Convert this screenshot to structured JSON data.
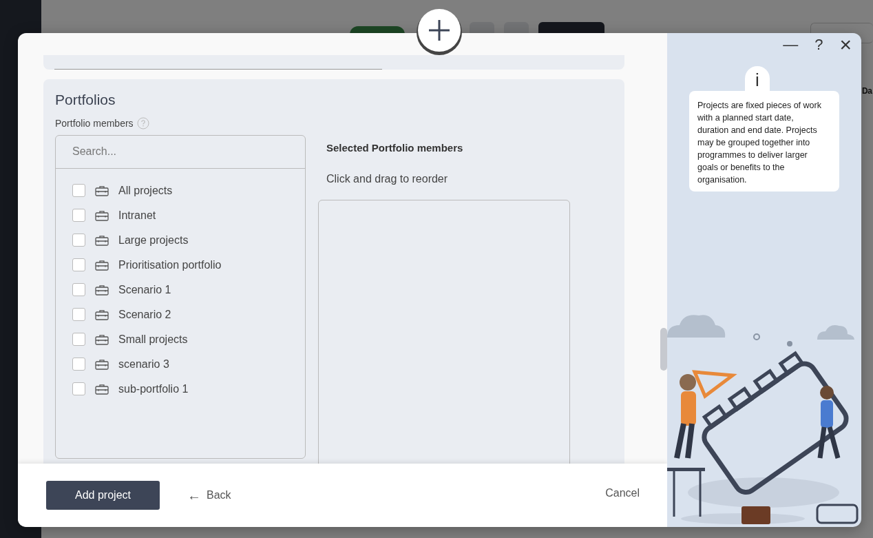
{
  "background": {
    "column_header": "Da"
  },
  "dialog": {
    "portfolios": {
      "title": "Portfolios",
      "members_label": "Portfolio members",
      "search": {
        "placeholder": "Search..."
      },
      "items": [
        {
          "label": "All projects",
          "checked": false
        },
        {
          "label": "Intranet",
          "checked": false
        },
        {
          "label": "Large projects",
          "checked": false
        },
        {
          "label": "Prioritisation portfolio",
          "checked": false
        },
        {
          "label": "Scenario 1",
          "checked": false
        },
        {
          "label": "Scenario 2",
          "checked": false
        },
        {
          "label": "Small projects",
          "checked": false
        },
        {
          "label": "scenario 3",
          "checked": false
        },
        {
          "label": "sub-portfolio 1",
          "checked": false
        }
      ],
      "selected_title": "Selected Portfolio members",
      "selected_hint": "Click and drag to reorder"
    },
    "footer": {
      "primary": "Add project",
      "back_arrow": "←",
      "back": "Back",
      "cancel": "Cancel"
    },
    "help": {
      "minimize": "—",
      "help": "?",
      "close": "×",
      "info_mark": "i",
      "info": "Projects are fixed pieces of work with a planned start date, duration and end date. Projects may be grouped together into programmes to deliver larger goals or benefits to the organisation."
    }
  }
}
